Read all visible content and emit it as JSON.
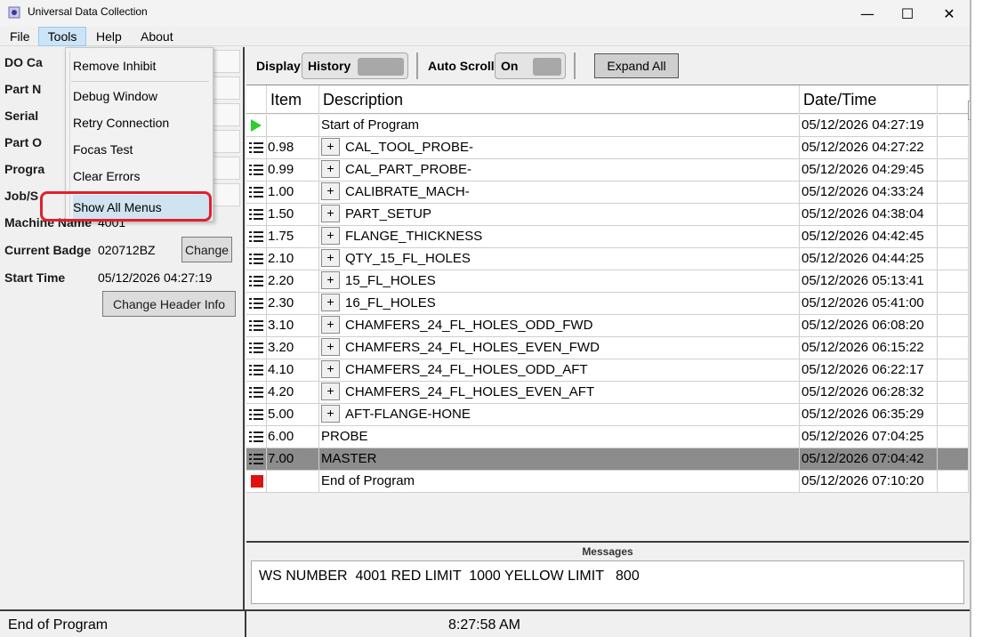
{
  "window": {
    "title": "Universal Data Collection",
    "minimize": "—",
    "maximize": "☐",
    "close": "✕"
  },
  "menubar": {
    "file": "File",
    "tools": "Tools",
    "help": "Help",
    "about": "About"
  },
  "tools_menu": {
    "items": [
      "Remove Inhibit",
      "Debug Window",
      "Retry Connection",
      "Focas Test",
      "Clear Errors",
      "Show All Menus"
    ],
    "highlighted": "Show All Menus"
  },
  "left_panel": {
    "labels_partial": [
      "DO Ca",
      "Part N",
      "Serial",
      "Part O",
      "Progra",
      "Job/S",
      "Machine Name"
    ],
    "machine_value_partial": "4001",
    "current_badge_label": "Current Badge",
    "current_badge_value": "020712BZ",
    "change_button": "Change",
    "start_time_label": "Start Time",
    "start_time_value": "05/12/2026 04:27:19",
    "change_header_button": "Change Header Info"
  },
  "toolbar": {
    "display_label": "Display",
    "display_toggle": "History",
    "autoscroll_label": "Auto Scroll",
    "autoscroll_toggle": "On",
    "expand_all": "Expand All"
  },
  "grid": {
    "columns": [
      "Item",
      "Description",
      "Date/Time"
    ],
    "rows": [
      {
        "icon": "play-icon",
        "item": "",
        "expandable": false,
        "description": "Start of Program",
        "datetime": "05/12/2026 04:27:19"
      },
      {
        "icon": "list-icon",
        "item": "0.98",
        "expandable": true,
        "description": "CAL_TOOL_PROBE-",
        "datetime": "05/12/2026 04:27:22"
      },
      {
        "icon": "list-icon",
        "item": "0.99",
        "expandable": true,
        "description": "CAL_PART_PROBE-",
        "datetime": "05/12/2026 04:29:45"
      },
      {
        "icon": "list-icon",
        "item": "1.00",
        "expandable": true,
        "description": "CALIBRATE_MACH-",
        "datetime": "05/12/2026 04:33:24"
      },
      {
        "icon": "list-icon",
        "item": "1.50",
        "expandable": true,
        "description": "PART_SETUP",
        "datetime": "05/12/2026 04:38:04"
      },
      {
        "icon": "list-icon",
        "item": "1.75",
        "expandable": true,
        "description": "FLANGE_THICKNESS",
        "datetime": "05/12/2026 04:42:45"
      },
      {
        "icon": "list-icon",
        "item": "2.10",
        "expandable": true,
        "description": "QTY_15_FL_HOLES",
        "datetime": "05/12/2026 04:44:25"
      },
      {
        "icon": "list-icon",
        "item": "2.20",
        "expandable": true,
        "description": "15_FL_HOLES",
        "datetime": "05/12/2026 05:13:41"
      },
      {
        "icon": "list-icon",
        "item": "2.30",
        "expandable": true,
        "description": "16_FL_HOLES",
        "datetime": "05/12/2026 05:41:00"
      },
      {
        "icon": "list-icon",
        "item": "3.10",
        "expandable": true,
        "description": "CHAMFERS_24_FL_HOLES_ODD_FWD",
        "datetime": "05/12/2026 06:08:20"
      },
      {
        "icon": "list-icon",
        "item": "3.20",
        "expandable": true,
        "description": "CHAMFERS_24_FL_HOLES_EVEN_FWD",
        "datetime": "05/12/2026 06:15:22"
      },
      {
        "icon": "list-icon",
        "item": "4.10",
        "expandable": true,
        "description": "CHAMFERS_24_FL_HOLES_ODD_AFT",
        "datetime": "05/12/2026 06:22:17"
      },
      {
        "icon": "list-icon",
        "item": "4.20",
        "expandable": true,
        "description": "CHAMFERS_24_FL_HOLES_EVEN_AFT",
        "datetime": "05/12/2026 06:28:32"
      },
      {
        "icon": "list-icon",
        "item": "5.00",
        "expandable": true,
        "description": "AFT-FLANGE-HONE",
        "datetime": "05/12/2026 06:35:29"
      },
      {
        "icon": "list-icon",
        "item": "6.00",
        "expandable": false,
        "description": "PROBE",
        "datetime": "05/12/2026 07:04:25"
      },
      {
        "icon": "list-icon",
        "item": "7.00",
        "expandable": false,
        "description": "MASTER",
        "datetime": "05/12/2026 07:04:42",
        "selected": true
      },
      {
        "icon": "stop-icon",
        "item": "",
        "expandable": false,
        "description": "End of Program",
        "datetime": "05/12/2026 07:10:20"
      }
    ],
    "expand_symbol": "+"
  },
  "messages": {
    "title": "Messages",
    "text": "WS NUMBER  4001 RED LIMIT  1000 YELLOW LIMIT   800"
  },
  "statusbar": {
    "left": "End of Program",
    "clock": "8:27:58 AM"
  }
}
